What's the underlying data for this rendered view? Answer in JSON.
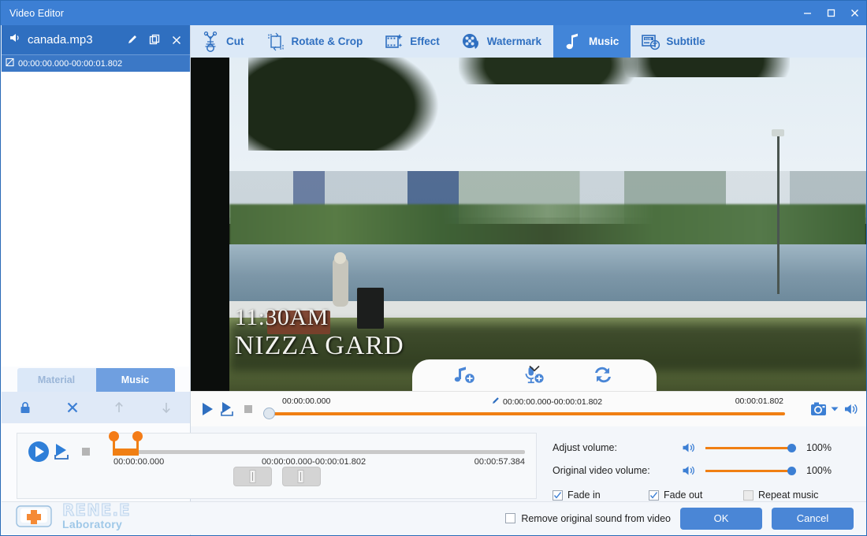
{
  "window": {
    "title": "Video Editor",
    "minimize_label": "minimize",
    "maximize_label": "maximize",
    "close_label": "close"
  },
  "toolbar": {
    "tabs": [
      {
        "label": "Cut",
        "icon": "scissors-icon",
        "active": false
      },
      {
        "label": "Rotate & Crop",
        "icon": "crop-rotate-icon",
        "active": false
      },
      {
        "label": "Effect",
        "icon": "effect-icon",
        "active": false
      },
      {
        "label": "Watermark",
        "icon": "watermark-icon",
        "active": false
      },
      {
        "label": "Music",
        "icon": "music-note-icon",
        "active": true
      },
      {
        "label": "Subtitle",
        "icon": "subtitle-icon",
        "active": false
      }
    ]
  },
  "sidebar": {
    "music_item": {
      "name": "canada.mp3",
      "speaker_icon": "speaker-icon",
      "edit_icon": "pencil-icon",
      "copy_icon": "copy-icon",
      "close_icon": "close-icon",
      "range": "00:00:00.000-00:00:01.802",
      "range_icon": "trim-range-icon"
    },
    "tabs": [
      {
        "label": "Material",
        "selected": false
      },
      {
        "label": "Music",
        "selected": true
      }
    ],
    "actions": [
      {
        "name": "lock-icon",
        "enabled": true
      },
      {
        "name": "delete-icon",
        "enabled": true
      },
      {
        "name": "move-up-icon",
        "enabled": false
      },
      {
        "name": "move-down-icon",
        "enabled": false
      }
    ]
  },
  "preview": {
    "overlay_text_line1": "11:30AM",
    "overlay_text_line2": "NIZZA GARD",
    "floating_tools": [
      {
        "name": "add-music-icon",
        "label": "Add music"
      },
      {
        "name": "add-voiceover-icon",
        "label": "Add voice over"
      },
      {
        "name": "replace-music-icon",
        "label": "Replace"
      }
    ],
    "collapse_icon": "chevron-down-icon"
  },
  "player": {
    "play_icon": "play-icon",
    "play_selection_icon": "play-selection-icon",
    "stop_icon": "stop-icon",
    "time_current": "00:00:00.000",
    "time_range": "00:00:00.000-00:00:01.802",
    "time_total": "00:00:01.802",
    "edit_icon": "pencil-icon",
    "snapshot_icon": "camera-icon",
    "snapshot_dropdown_icon": "caret-down-icon",
    "volume_icon": "speaker-icon"
  },
  "music_panel": {
    "play_icon": "play-icon",
    "play_selection_icon": "play-selection-icon",
    "stop_icon": "stop-icon",
    "time_start": "00:00:00.000",
    "time_range": "00:00:00.000-00:00:01.802",
    "time_end": "00:00:57.384",
    "trim_start_button": "set-start-icon",
    "trim_end_button": "set-end-icon"
  },
  "settings": {
    "adjust_volume_label": "Adjust volume:",
    "adjust_volume_value": "100%",
    "original_volume_label": "Original video volume:",
    "original_volume_value": "100%",
    "fade_in": {
      "label": "Fade in",
      "checked": true
    },
    "fade_out": {
      "label": "Fade out",
      "checked": true
    },
    "repeat_music": {
      "label": "Repeat music",
      "checked": false,
      "enabled": false
    }
  },
  "footer": {
    "logo_line1": "RENE.E",
    "logo_line2": "Laboratory",
    "remove_sound_label": "Remove original sound from video",
    "remove_sound_checked": false,
    "ok_label": "OK",
    "cancel_label": "Cancel"
  },
  "colors": {
    "accent_blue": "#3c7fd4",
    "tab_active": "#4285d8",
    "slider_orange": "#f07f13",
    "panel_bg": "#f3f6fa"
  }
}
